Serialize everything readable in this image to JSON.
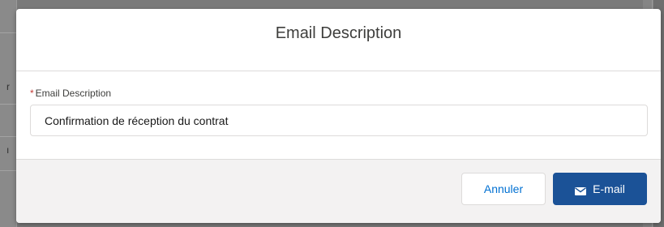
{
  "background": {
    "left_fragments": [
      "r",
      "ı"
    ]
  },
  "modal": {
    "title": "Email Description",
    "field": {
      "required_mark": "*",
      "label": "Email Description",
      "value": "Confirmation de réception du contrat"
    },
    "footer": {
      "cancel_label": "Annuler",
      "email_label": "E-mail",
      "email_icon": "envelope-icon"
    }
  },
  "colors": {
    "brand_button": "#1b5297",
    "link_blue": "#0070d2",
    "required_red": "#c23934"
  }
}
